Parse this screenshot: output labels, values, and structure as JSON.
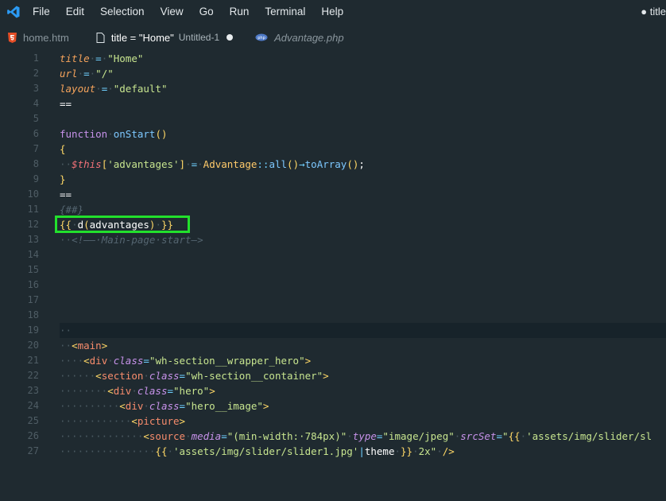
{
  "menubar": {
    "items": [
      "File",
      "Edit",
      "Selection",
      "View",
      "Go",
      "Run",
      "Terminal",
      "Help"
    ],
    "window_title": "● title"
  },
  "tabs": [
    {
      "label": "home.htm",
      "icon": "html5-icon",
      "active": false
    },
    {
      "label": "title = \"Home\"",
      "sub": "Untitled-1",
      "icon": "file-icon",
      "active": true,
      "dirty": true
    },
    {
      "label": "Advantage.php",
      "icon": "php-icon",
      "active": false
    }
  ],
  "editor": {
    "line_numbers": [
      "1",
      "2",
      "3",
      "4",
      "5",
      "6",
      "7",
      "8",
      "9",
      "10",
      "11",
      "12",
      "13",
      "14",
      "15",
      "16",
      "17",
      "18",
      "19",
      "20",
      "21",
      "22",
      "23",
      "24",
      "25",
      "26",
      "27"
    ]
  },
  "colors": {
    "background": "#1f2a30",
    "highlight_box": "#22e02c",
    "vscode_blue": "#2b9af3"
  }
}
